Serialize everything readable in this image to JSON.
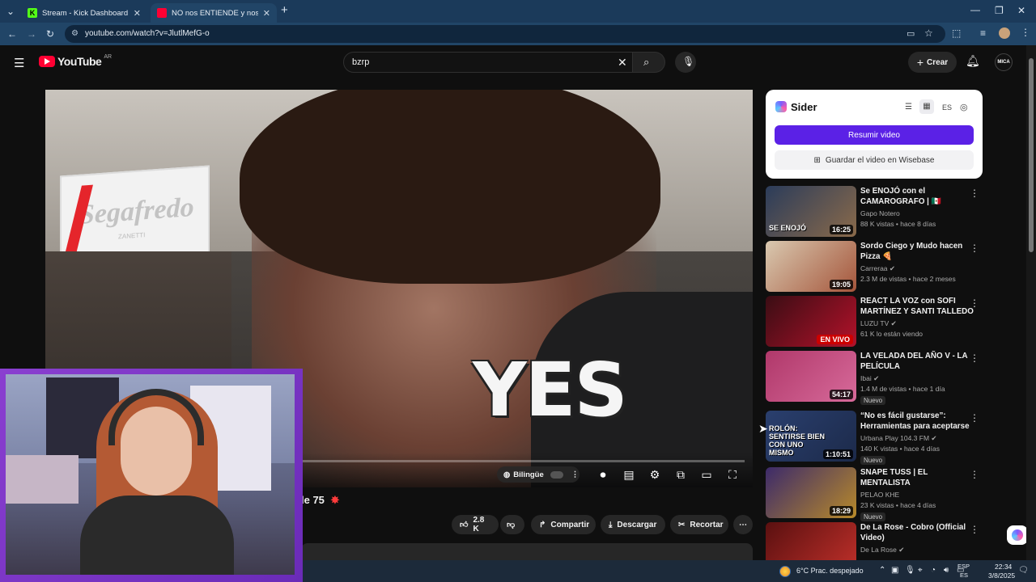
{
  "browser": {
    "tabs": [
      {
        "label": "Stream - Kick Dashboard",
        "favicon_color": "#53fc18"
      },
      {
        "label": "NO nos ENTIENDE y nos ESCRA",
        "favicon_color": "#ff0033"
      }
    ],
    "url": "youtube.com/watch?v=JlutlMefG-o"
  },
  "youtube": {
    "logo_text": "YouTube",
    "region": "AR",
    "search_value": "bzrp",
    "create_label": "Crear",
    "avatar_text": "MICA"
  },
  "video": {
    "overlay_caption": "YES",
    "sign_text": "Segafredo",
    "sign_subtext": "ZANETTI",
    "title_fragment": "le 75",
    "bilingual_label": "Bilingüe"
  },
  "actions": {
    "likes": "2.8 K",
    "share": "Compartir",
    "download": "Descargar",
    "clip": "Recortar"
  },
  "sider": {
    "brand": "Sider",
    "lang": "ES",
    "summarize": "Resumir video",
    "save": "Guardar el video en Wisebase"
  },
  "recommended": [
    {
      "title": "Se ENOJÓ con el CAMAROGRAFO | 🇲🇽 Random ...",
      "channel": "Gapo Notero",
      "meta": "88 K vistas • hace 8 días",
      "duration": "16:25",
      "thumb_text": "SE ENOJÓ",
      "badge": "",
      "verified": false,
      "colors": [
        "#2b3c5a",
        "#8a6a4a"
      ]
    },
    {
      "title": "Sordo Ciego y Mudo hacen Pizza 🍕",
      "channel": "Carreraa",
      "meta": "2.3 M de vistas • hace 2 meses",
      "duration": "19:05",
      "thumb_text": "",
      "badge": "",
      "verified": true,
      "colors": [
        "#d9c9b0",
        "#a5553b"
      ]
    },
    {
      "title": "REACT LA VOZ con SOFI MARTÍNEZ Y SANTI TALLEDO ...",
      "channel": "LUZU TV",
      "meta": "61 K lo están viendo",
      "duration": "",
      "live": "EN VIVO",
      "thumb_text": "",
      "badge": "",
      "verified": true,
      "colors": [
        "#3a0d14",
        "#b3122a"
      ]
    },
    {
      "title": "LA VELADA DEL AÑO V - LA PELÍCULA",
      "channel": "Ibai",
      "meta": "1.4 M de vistas • hace 1 día",
      "duration": "54:17",
      "thumb_text": "",
      "badge": "Nuevo",
      "verified": true,
      "colors": [
        "#b0386a",
        "#d76a9a"
      ]
    },
    {
      "title": "“No es fácil gustarse”: Herramientas para aceptarse ...",
      "channel": "Urbana Play 104.3 FM",
      "meta": "140 K vistas • hace 4 días",
      "duration": "1:10:51",
      "thumb_text": "ROLÓN: SENTIRSE BIEN CON UNO MISMO",
      "badge": "Nuevo",
      "verified": true,
      "colors": [
        "#2a3f6e",
        "#1c2a4a"
      ]
    },
    {
      "title": "SNAPE TUSS | EL MENTALISTA",
      "channel": "PELAO KHE",
      "meta": "23 K vistas • hace 4 días",
      "duration": "18:29",
      "thumb_text": "",
      "badge": "Nuevo",
      "verified": false,
      "colors": [
        "#3c2a6a",
        "#b88a2a"
      ]
    },
    {
      "title": "De La Rose - Cobro (Official Video)",
      "channel": "De La Rose",
      "meta": "",
      "duration": "",
      "thumb_text": "",
      "badge": "",
      "verified": true,
      "colors": [
        "#5a1010",
        "#c0302a"
      ]
    }
  ],
  "taskbar": {
    "weather": "6°C  Prac. despejado",
    "lang_top": "ESP",
    "lang_bottom": "ES",
    "time": "22:34",
    "date": "3/8/2025"
  }
}
